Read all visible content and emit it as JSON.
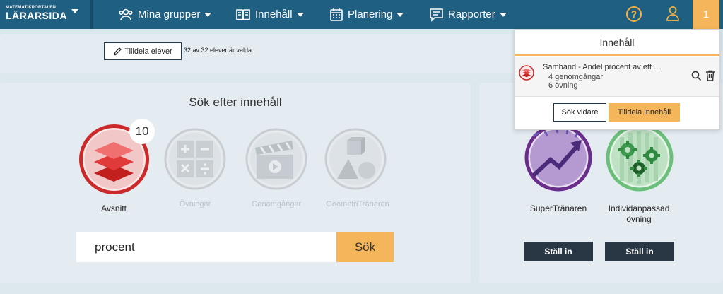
{
  "navbar": {
    "logo_small": "MATEMATIKPORTALEN",
    "logo_big": "LÄRARSIDA",
    "items": [
      {
        "label": "Mina grupper",
        "icon": "users-icon"
      },
      {
        "label": "Innehåll",
        "icon": "book-icon"
      },
      {
        "label": "Planering",
        "icon": "calendar-icon"
      },
      {
        "label": "Rapporter",
        "icon": "report-icon"
      }
    ],
    "help_label": "?",
    "badge_count": "1"
  },
  "assign": {
    "button_label": "Tilldela elever",
    "note": "32 av 32 elever är valda."
  },
  "search": {
    "title": "Sök efter innehåll",
    "count_badge": "10",
    "categories": [
      {
        "label": "Avsnitt",
        "icon": "layers-icon",
        "active": true
      },
      {
        "label": "Övningar",
        "icon": "math-operators-icon",
        "active": false
      },
      {
        "label": "Genomgångar",
        "icon": "clapperboard-icon",
        "active": false
      },
      {
        "label": "GeometriTränaren",
        "icon": "geometry-shapes-icon",
        "active": false
      }
    ],
    "input_value": "procent",
    "button_label": "Sök"
  },
  "trainers": [
    {
      "label": "SuperTränaren",
      "button_label": "Ställ in",
      "color": "#6a2d8a"
    },
    {
      "label_line1": "Individanpassad",
      "label_line2": "övning",
      "button_label": "Ställ in",
      "color": "#6cbf7a"
    }
  ],
  "dropdown": {
    "title": "Innehåll",
    "item": {
      "title": "Samband - Andel procent av ett ...",
      "sub1": "4 genomgångar",
      "sub2": "6 övning"
    },
    "search_more_label": "Sök vidare",
    "assign_label": "Tilldela innehåll"
  },
  "colors": {
    "navbar": "#1f5f82",
    "accent": "#f5b55a",
    "background": "#dde7ee",
    "dark_button": "#283743"
  }
}
